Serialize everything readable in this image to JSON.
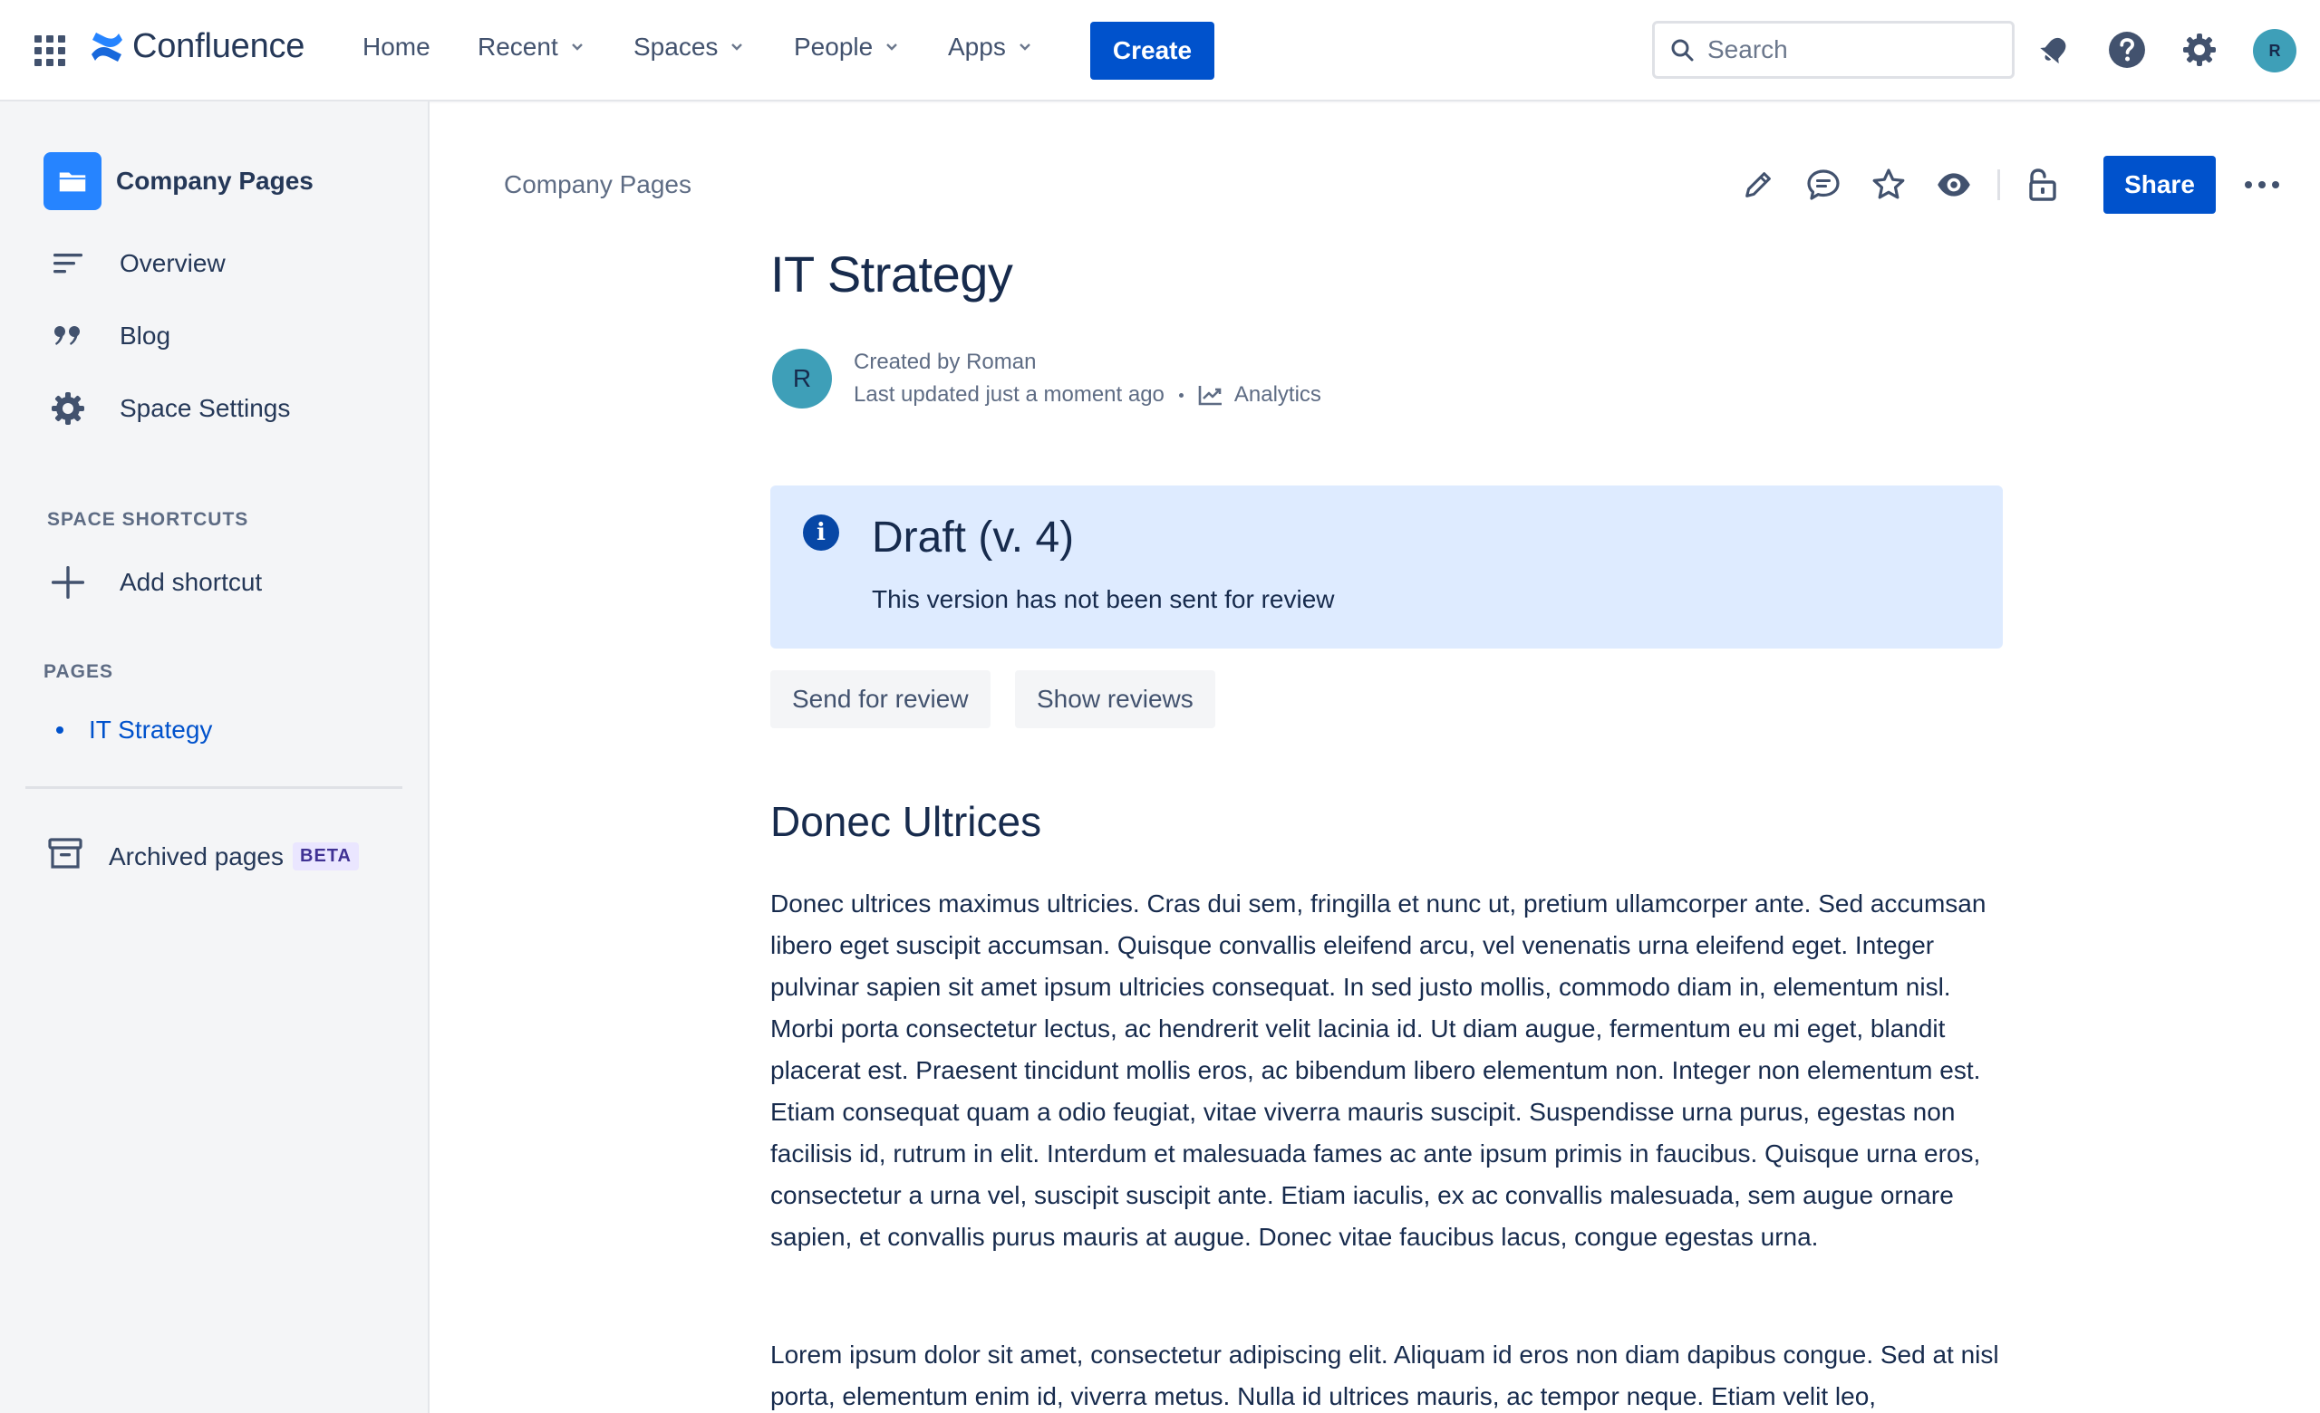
{
  "topnav": {
    "brand": "Confluence",
    "items": [
      {
        "label": "Home"
      },
      {
        "label": "Recent"
      },
      {
        "label": "Spaces"
      },
      {
        "label": "People"
      },
      {
        "label": "Apps"
      }
    ],
    "create_label": "Create",
    "search_placeholder": "Search",
    "user_initial": "R",
    "icons": [
      "app-switcher-icon",
      "notifications-icon",
      "help-icon",
      "settings-icon"
    ]
  },
  "sidebar": {
    "space_name": "Company Pages",
    "items": [
      {
        "label": "Overview",
        "icon": "overview-icon"
      },
      {
        "label": "Blog",
        "icon": "quote-icon"
      },
      {
        "label": "Space Settings",
        "icon": "gear-icon"
      }
    ],
    "shortcuts_heading": "SPACE SHORTCUTS",
    "add_shortcut_label": "Add shortcut",
    "pages_heading": "PAGES",
    "pages": [
      {
        "label": "IT Strategy"
      }
    ],
    "archived_label": "Archived pages",
    "archived_badge": "BETA"
  },
  "main": {
    "breadcrumb": "Company Pages",
    "share_label": "Share",
    "title": "IT Strategy",
    "author_initial": "R",
    "created_by": "Created by Roman",
    "last_updated": "Last updated just a moment ago",
    "analytics_label": "Analytics",
    "panel": {
      "title": "Draft (v. 4)",
      "text": "This version has not been sent for review",
      "color": "#deebff"
    },
    "send_review_label": "Send for review",
    "show_reviews_label": "Show reviews",
    "section_heading": "Donec Ultrices",
    "paragraphs": [
      "Donec ultrices maximus ultricies. Cras dui sem, fringilla et nunc ut, pretium ullamcorper ante. Sed accumsan libero eget suscipit accumsan. Quisque convallis eleifend arcu, vel venenatis urna eleifend eget. Integer pulvinar sapien sit amet ipsum ultricies consequat. In sed justo mollis, commodo diam in, elementum nisl. Morbi porta consectetur lectus, ac hendrerit velit lacinia id. Ut diam augue, fermentum eu mi eget, blandit placerat est. Praesent tincidunt mollis eros, ac bibendum libero elementum non. Integer non elementum est. Etiam consequat quam a odio feugiat, vitae viverra mauris suscipit. Suspendisse urna purus, egestas non facilisis id, rutrum in elit. Interdum et malesuada fames ac ante ipsum primis in faucibus. Quisque urna eros, consectetur a urna vel, suscipit suscipit ante. Etiam iaculis, ex ac convallis malesuada, sem augue ornare sapien, et convallis purus mauris at augue. Donec vitae faucibus lacus, congue egestas urna.",
      "Lorem ipsum dolor sit amet, consectetur adipiscing elit. Aliquam id eros non diam dapibus congue. Sed at nisl porta, elementum enim id, viverra metus. Nulla id ultrices mauris, ac tempor neque. Etiam velit leo,"
    ]
  },
  "colors": {
    "primary": "#0052cc",
    "text": "#172b4d",
    "sidebar_bg": "#f4f5f7",
    "avatar": "#3e9fb8"
  }
}
